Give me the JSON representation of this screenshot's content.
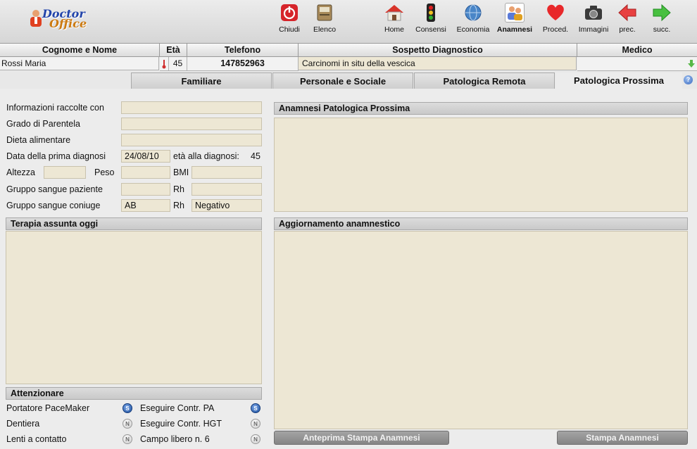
{
  "app": {
    "logo_line1": "Doctor",
    "logo_line2": "Office"
  },
  "toolbar": {
    "chiudi": "Chiudi",
    "elenco": "Elenco",
    "home": "Home",
    "consensi": "Consensi",
    "economia": "Economia",
    "anamnesi": "Anamnesi",
    "proced": "Proced.",
    "immagini": "Immagini",
    "prec": "prec.",
    "succ": "succ."
  },
  "patient_header": {
    "name": "Cognome e Nome",
    "age": "Età",
    "phone": "Telefono",
    "diagnosis": "Sospetto Diagnostico",
    "doctor": "Medico"
  },
  "patient": {
    "name": "Rossi Maria",
    "age": "45",
    "phone": "147852963",
    "diagnosis": "Carcinomi in situ della vescica",
    "doctor": ""
  },
  "tabs": [
    "Familiare",
    "Personale e Sociale",
    "Patologica Remota",
    "Patologica Prossima"
  ],
  "form": {
    "info_raccolte_label": "Informazioni raccolte con",
    "info_raccolte_value": "",
    "grado_parentela_label": "Grado di Parentela",
    "grado_parentela_value": "",
    "dieta_label": "Dieta alimentare",
    "dieta_value": "",
    "data_diagnosi_label": "Data della prima diagnosi",
    "data_diagnosi_value": "24/08/10",
    "eta_diagnosi_label": "età alla diagnosi:",
    "eta_diagnosi_value": "45",
    "altezza_label": "Altezza",
    "altezza_value": "",
    "peso_label": "Peso",
    "peso_value": "",
    "bmi_label": "BMI",
    "bmi_value": "",
    "gruppo_paziente_label": "Gruppo sangue paziente",
    "gruppo_paziente_value": "",
    "rh_label": "Rh",
    "rh_paziente_value": "",
    "gruppo_coniuge_label": "Gruppo sangue coniuge",
    "gruppo_coniuge_value": "AB",
    "rh_coniuge_value": "Negativo"
  },
  "sections": {
    "anamnesi_prossima": "Anamnesi Patologica Prossima",
    "terapia": "Terapia assunta oggi",
    "aggiornamento": "Aggiornamento anamnestico",
    "attenzionare": "Attenzionare"
  },
  "attenzionare": {
    "pacemaker": "Portatore PaceMaker",
    "pacemaker_flag": "S",
    "contr_pa": "Eseguire Contr. PA",
    "contr_pa_flag": "S",
    "dentiera": "Dentiera",
    "dentiera_flag": "N",
    "contr_hgt": "Eseguire Contr. HGT",
    "contr_hgt_flag": "N",
    "lenti": "Lenti a contatto",
    "lenti_flag": "N",
    "campo6": "Campo libero n. 6",
    "campo6_flag": "N"
  },
  "buttons": {
    "anteprima": "Anteprima Stampa Anamnesi",
    "stampa": "Stampa Anamnesi"
  },
  "colors": {
    "field_bg": "#ede7d4",
    "button_bg": "#8c8c8c",
    "toolbar_bg": "#dcdcdc"
  }
}
